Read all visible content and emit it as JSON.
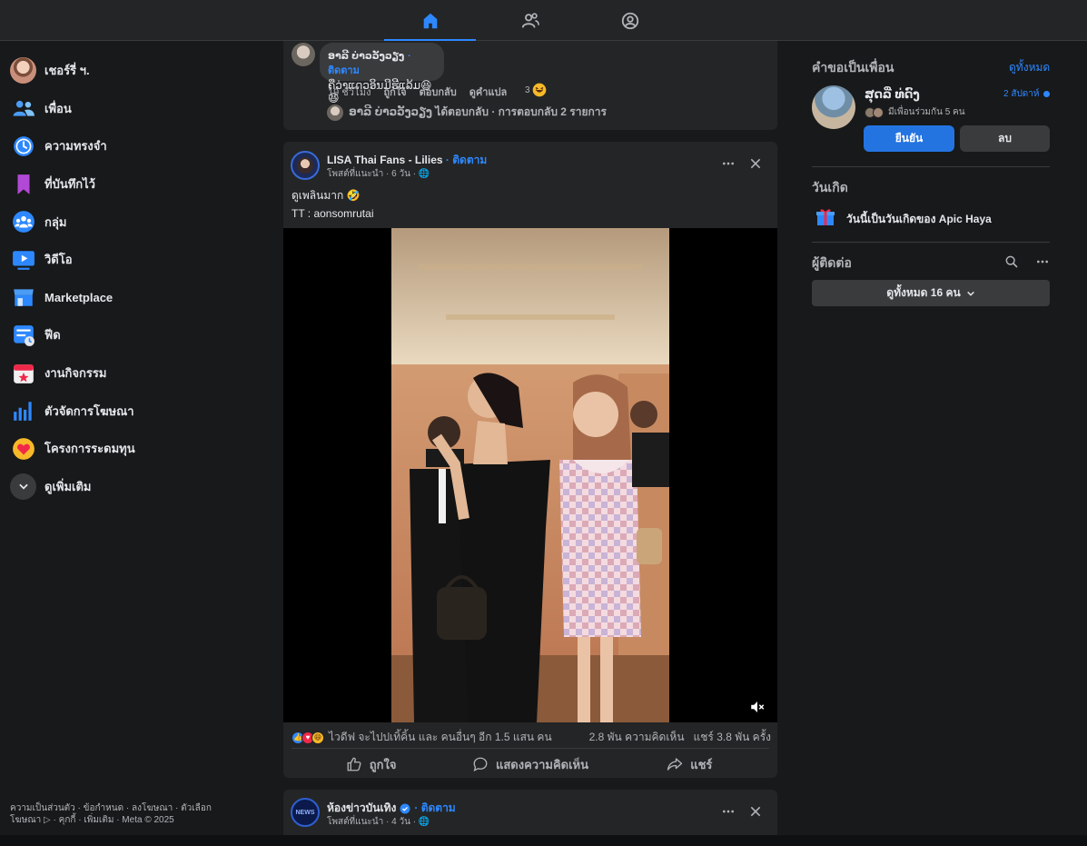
{
  "nav": {
    "tabs": [
      "home",
      "friends",
      "profile"
    ]
  },
  "sidebar": {
    "profile_name": "เชอร์รี่ ฯ.",
    "items": [
      {
        "label": "เพื่อน",
        "icon": "friends-icon"
      },
      {
        "label": "ความทรงจำ",
        "icon": "memories-icon"
      },
      {
        "label": "ที่บันทึกไว้",
        "icon": "saved-icon"
      },
      {
        "label": "กลุ่ม",
        "icon": "groups-icon"
      },
      {
        "label": "วิดีโอ",
        "icon": "video-icon"
      },
      {
        "label": "Marketplace",
        "icon": "marketplace-icon"
      },
      {
        "label": "ฟีด",
        "icon": "feeds-icon"
      },
      {
        "label": "งานกิจกรรม",
        "icon": "events-icon"
      },
      {
        "label": "ตัวจัดการโฆษณา",
        "icon": "ads-manager-icon"
      },
      {
        "label": "โครงการระดมทุน",
        "icon": "fundraisers-icon"
      }
    ],
    "see_more": "ดูเพิ่มเติม",
    "footer": "ความเป็นส่วนตัว · ข้อกำหนด · ลงโฆษณา · ตัวเลือกโฆษณา ▷ · คุกกี้ · เพิ่มเติม · Meta © 2025"
  },
  "comment": {
    "author": "ອາລີ ບ່າວວັງວຽງ",
    "follow": "· ติดตาม",
    "text": "ຄືວ່າແດວອິນມີຮີແລ້ມ😆😆",
    "time": "19 ชั่วโมง",
    "like": "ถูกใจ",
    "reply": "ตอบกลับ",
    "translate": "ดูคำแปล",
    "reaction_count": "3",
    "reply_summary": "ອາລີ ບ່າວວັງວຽງ ได้ตอบกลับ · การตอบกลับ 2 รายการ"
  },
  "post": {
    "page_name": "LISA Thai Fans - Lilies",
    "follow": "· ติดตาม",
    "subtitle": "โพสต์ที่แนะนำ · 6 วัน · 🌐",
    "text_line1": "ดูเพลินมาก 🤣",
    "text_line2": "TT : aonsomrutai",
    "reactions_summary": "ไวดีฟ จะไปปเทิ้คิ้น และ คนอื่นๆ อีก 1.5 แสน คน",
    "comments_count": "2.8 พัน ความคิดเห็น",
    "shares_count": "แชร์ 3.8 พัน ครั้ง",
    "like_label": "ถูกใจ",
    "comment_label": "แสดงความคิดเห็น",
    "share_label": "แชร์"
  },
  "next_post": {
    "page_name": "ห้องข่าวบันเทิง",
    "follow": "· ติดตาม",
    "subtitle": "โพสต์ที่แนะนำ · 4 วัน · 🌐",
    "avatar_text": "NEWS"
  },
  "right": {
    "friend_requests_title": "คำขอเป็นเพื่อน",
    "see_all": "ดูทั้งหมด",
    "request": {
      "name": "ສຸດລີ່ ທ່ດົງ",
      "time": "2 สัปดาห์",
      "mutual": "มีเพื่อนร่วมกัน 5 คน",
      "confirm": "ยืนยัน",
      "delete": "ลบ"
    },
    "birthdays_title": "วันเกิด",
    "birthday_text": "วันนี้เป็นวันเกิดของ Apic Haya",
    "contacts_title": "ผู้ติดต่อ",
    "contacts_see_all": "ดูทั้งหมด 16 คน"
  },
  "colors": {
    "accent": "#2d88ff",
    "bg": "#18191a",
    "card": "#242526",
    "button": "#2374e1"
  }
}
